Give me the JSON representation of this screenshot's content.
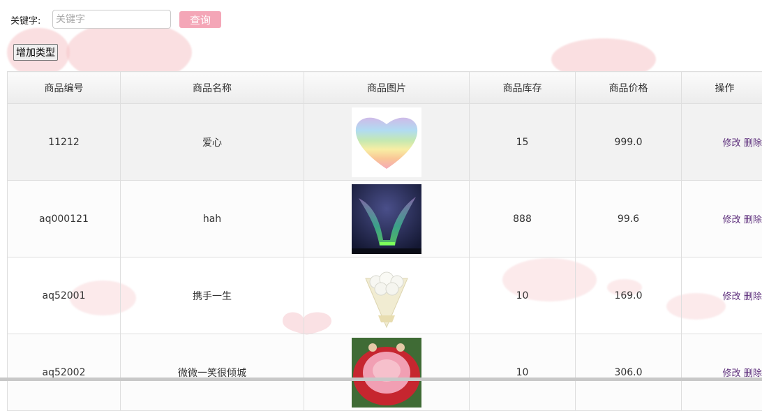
{
  "search": {
    "label": "关键字:",
    "placeholder": "关键字",
    "value": "",
    "button_label": "查询"
  },
  "toolbar": {
    "add_label": "增加类型"
  },
  "table": {
    "headers": [
      "商品编号",
      "商品名称",
      "商品图片",
      "商品库存",
      "商品价格",
      "操作"
    ],
    "rows": [
      {
        "id": "11212",
        "name": "爱心",
        "image": "rainbow-heart-icon",
        "stock": "15",
        "price": "999.0",
        "edit": "修改",
        "delete": "删除"
      },
      {
        "id": "aq000121",
        "name": "hah",
        "image": "aurora-photo",
        "stock": "888",
        "price": "99.6",
        "edit": "修改",
        "delete": "删除"
      },
      {
        "id": "aq52001",
        "name": "携手一生",
        "image": "white-rose-bouquet",
        "stock": "10",
        "price": "169.0",
        "edit": "修改",
        "delete": "删除"
      },
      {
        "id": "aq52002",
        "name": "微微一笑很倾城",
        "image": "pink-red-rose-box",
        "stock": "10",
        "price": "306.0",
        "edit": "修改",
        "delete": "删除"
      }
    ]
  },
  "colors": {
    "search_button": "#f4a6b7",
    "link": "#5b2c7a",
    "background_blobs": "#f6c6c9"
  }
}
